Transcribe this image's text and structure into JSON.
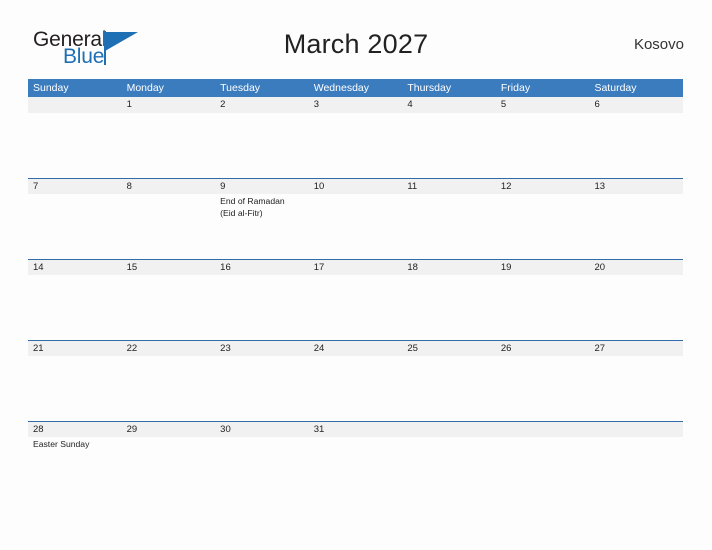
{
  "brand": {
    "name_part1": "General",
    "name_part2": "Blue",
    "flag_icon": "flag-triangle-icon",
    "accent_color": "#1f6fb5"
  },
  "header": {
    "title": "March 2027",
    "location": "Kosovo"
  },
  "theme": {
    "header_blue": "#3b7cbf",
    "rule_blue": "#2f6ca8",
    "date_row_bg": "#f1f1f1",
    "page_bg": "#fdfdfd",
    "text_color": "#222222"
  },
  "calendar": {
    "month": "March",
    "year": "2027",
    "day_names": [
      "Sunday",
      "Monday",
      "Tuesday",
      "Wednesday",
      "Thursday",
      "Friday",
      "Saturday"
    ],
    "weeks": [
      {
        "days": [
          {
            "date": "",
            "events": []
          },
          {
            "date": "1",
            "events": []
          },
          {
            "date": "2",
            "events": []
          },
          {
            "date": "3",
            "events": []
          },
          {
            "date": "4",
            "events": []
          },
          {
            "date": "5",
            "events": []
          },
          {
            "date": "6",
            "events": []
          }
        ]
      },
      {
        "days": [
          {
            "date": "7",
            "events": []
          },
          {
            "date": "8",
            "events": []
          },
          {
            "date": "9",
            "events": [
              "End of Ramadan",
              "(Eid al-Fitr)"
            ]
          },
          {
            "date": "10",
            "events": []
          },
          {
            "date": "11",
            "events": []
          },
          {
            "date": "12",
            "events": []
          },
          {
            "date": "13",
            "events": []
          }
        ]
      },
      {
        "days": [
          {
            "date": "14",
            "events": []
          },
          {
            "date": "15",
            "events": []
          },
          {
            "date": "16",
            "events": []
          },
          {
            "date": "17",
            "events": []
          },
          {
            "date": "18",
            "events": []
          },
          {
            "date": "19",
            "events": []
          },
          {
            "date": "20",
            "events": []
          }
        ]
      },
      {
        "days": [
          {
            "date": "21",
            "events": []
          },
          {
            "date": "22",
            "events": []
          },
          {
            "date": "23",
            "events": []
          },
          {
            "date": "24",
            "events": []
          },
          {
            "date": "25",
            "events": []
          },
          {
            "date": "26",
            "events": []
          },
          {
            "date": "27",
            "events": []
          }
        ]
      },
      {
        "days": [
          {
            "date": "28",
            "events": [
              "Easter Sunday"
            ]
          },
          {
            "date": "29",
            "events": []
          },
          {
            "date": "30",
            "events": []
          },
          {
            "date": "31",
            "events": []
          },
          {
            "date": "",
            "events": []
          },
          {
            "date": "",
            "events": []
          },
          {
            "date": "",
            "events": []
          }
        ]
      }
    ]
  }
}
